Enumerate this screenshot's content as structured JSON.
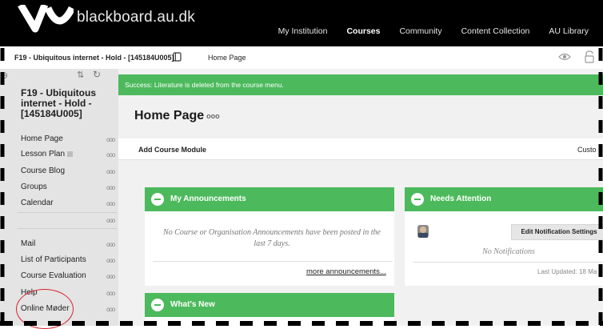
{
  "header": {
    "logo_text": "blackboard.au.dk",
    "nav": [
      {
        "label": "My Institution",
        "active": false
      },
      {
        "label": "Courses",
        "active": true
      },
      {
        "label": "Community",
        "active": false
      },
      {
        "label": "Content Collection",
        "active": false
      },
      {
        "label": "AU Library",
        "active": false
      }
    ]
  },
  "breadcrumb": {
    "course": "F19 - Ubiquitous internet - Hold - [145184U005]",
    "page": "Home Page"
  },
  "sidebar": {
    "course_title": "F19 - Ubiquitous internet - Hold - [145184U005]",
    "items": [
      {
        "label": "Home Page"
      },
      {
        "label": "Lesson Plan"
      },
      {
        "label": "Course Blog"
      },
      {
        "label": "Groups"
      },
      {
        "label": "Calendar"
      },
      {
        "label": "Mail"
      },
      {
        "label": "List of Participants"
      },
      {
        "label": "Course Evaluation"
      },
      {
        "label": "Help"
      },
      {
        "label": "Online Møder"
      }
    ],
    "dots": "ooo"
  },
  "main": {
    "success_message": "Success: Literature is deleted from the course menu.",
    "page_title": "Home Page",
    "title_dots": "ooo",
    "toolbar": {
      "add_module": "Add Course Module",
      "customize": "Custo"
    },
    "announcements": {
      "title": "My Announcements",
      "body": "No Course or Organisation Announcements have been posted in the last 7 days.",
      "more_link": "more announcements..."
    },
    "needs_attention": {
      "title": "Needs Attention",
      "button": "Edit Notification Settings",
      "empty": "No Notifications",
      "updated": "Last Updated: 18 Ma"
    },
    "whats_new": {
      "title": "What's New"
    }
  },
  "colors": {
    "success_green": "#4cba5c",
    "header_black": "#000000",
    "annotation_red": "#d9232e"
  }
}
